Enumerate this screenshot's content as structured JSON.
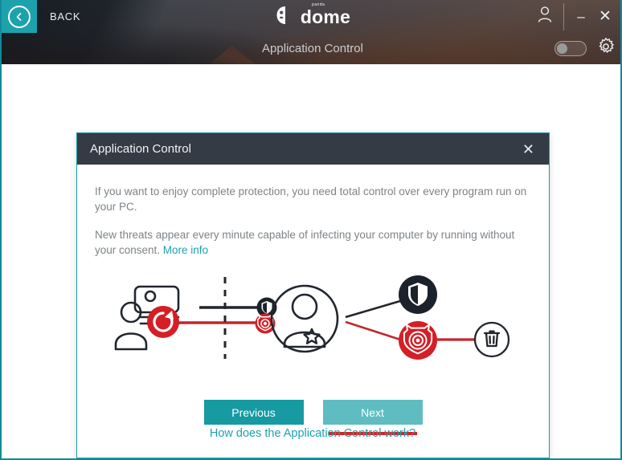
{
  "window": {
    "back_label": "BACK",
    "back_icon": "chevron-left-icon",
    "brand_sup": "panda",
    "brand_name": "dome",
    "brand_icon": "panda-logo-icon",
    "account_icon": "user-icon",
    "minimize_label": "–",
    "close_label": "✕",
    "accent_color": "#1ba2ad",
    "header_bg_color": "#343b45"
  },
  "module_bar": {
    "title": "Application Control",
    "toggle_state": "off",
    "toggle_name": "application-control-toggle",
    "gear_icon": "gear-icon"
  },
  "dialog": {
    "title": "Application Control",
    "close_label": "✕",
    "paragraph_1": "If you want to enjoy complete protection, you need total control over every program run on your PC.",
    "paragraph_2_before": "New threats appear every minute capable of infecting your computer by running without your consent. ",
    "more_info_label": "More info",
    "buttons": {
      "previous_label": "Previous",
      "next_label": "Next",
      "previous_color": "#179aa1",
      "next_color": "#5fbdc1",
      "next_underline_color": "#e01f22"
    },
    "illustration": {
      "name": "application-control-flow-diagram",
      "nodes": [
        "user-at-computer-icon",
        "red-refresh-icon",
        "dashed-divider",
        "dark-shield-icon",
        "red-virus-shield-icon",
        "admin-user-icon",
        "dark-shield-badge-icon",
        "red-virus-badge-icon",
        "trash-bin-icon"
      ],
      "line_colors": {
        "allow": "#22262e",
        "block": "#c0282d"
      }
    }
  },
  "footer": {
    "help_link_label": "How does the Application Control work?",
    "help_link_color": "#1ba2ad"
  }
}
